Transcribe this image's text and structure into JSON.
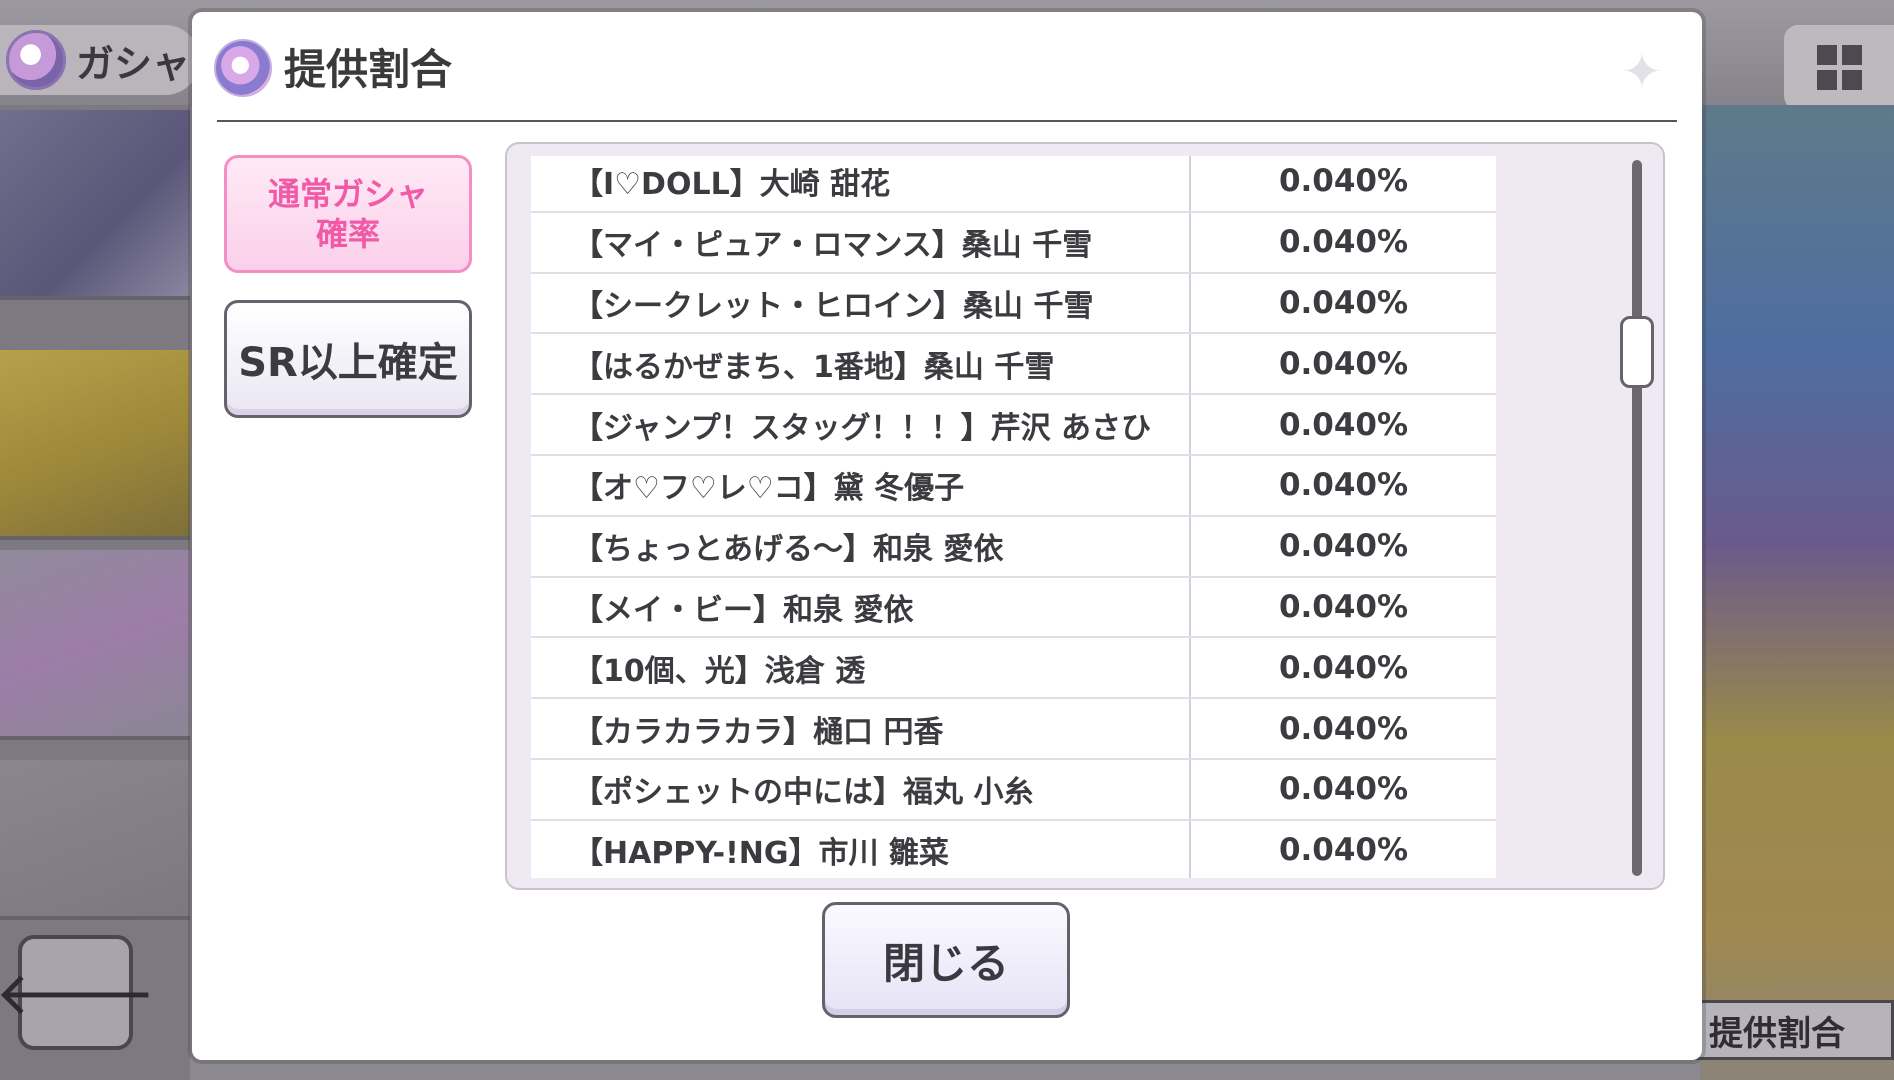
{
  "background": {
    "header_title": "ガシャ",
    "right_label": "提供割合"
  },
  "dialog": {
    "title": "提供割合",
    "tabs": [
      {
        "line1": "通常ガシャ",
        "line2": "確率"
      },
      {
        "label": "SR以上確定"
      }
    ],
    "close_label": "閉じる"
  },
  "rates": {
    "rows": [
      {
        "name": "【I♡DOLL】大崎 甜花",
        "rate": "0.040%"
      },
      {
        "name": "【マイ・ピュア・ロマンス】桑山 千雪",
        "rate": "0.040%"
      },
      {
        "name": "【シークレット・ヒロイン】桑山 千雪",
        "rate": "0.040%"
      },
      {
        "name": "【はるかぜまち、1番地】桑山 千雪",
        "rate": "0.040%"
      },
      {
        "name": "【ジャンプ！スタッグ！！！】芹沢 あさひ",
        "rate": "0.040%"
      },
      {
        "name": "【オ♡フ♡レ♡コ】黛 冬優子",
        "rate": "0.040%"
      },
      {
        "name": "【ちょっとあげる〜】和泉 愛依",
        "rate": "0.040%"
      },
      {
        "name": "【メイ・ビー】和泉 愛依",
        "rate": "0.040%"
      },
      {
        "name": "【10個、光】浅倉 透",
        "rate": "0.040%"
      },
      {
        "name": "【カラカラカラ】樋口 円香",
        "rate": "0.040%"
      },
      {
        "name": "【ポシェットの中には】福丸 小糸",
        "rate": "0.040%"
      },
      {
        "name": "【HAPPY-!NG】市川 雛菜",
        "rate": "0.040%"
      }
    ]
  }
}
